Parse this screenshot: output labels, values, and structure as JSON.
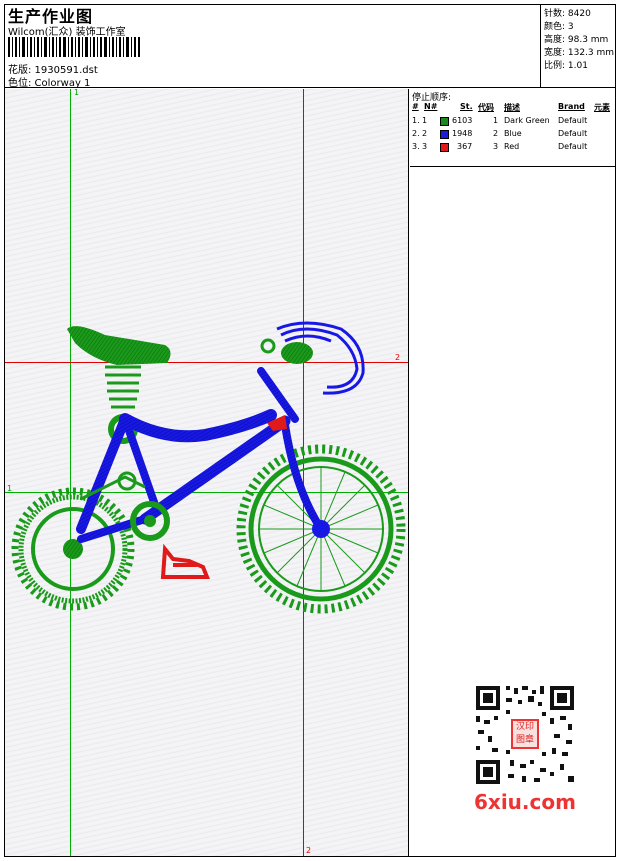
{
  "header": {
    "title": "生产作业图",
    "company": "Wilcom(汇众) 装饰工作室",
    "design_file": "花版: 1930591.dst",
    "colorway": "色位: Colorway 1"
  },
  "stats": {
    "stitches": "针数: 8420",
    "colors": "颜色: 3",
    "height": "高度: 98.3 mm",
    "width": "宽度: 132.3 mm",
    "scale": "比例: 1.01"
  },
  "guides": {
    "top_label": "1",
    "left_label": "1",
    "right_label": "2",
    "bottom_label": "2"
  },
  "stop_sequence": {
    "title": "停止顺序:",
    "headers": {
      "num": "#",
      "n": "N#",
      "st": "St.",
      "code": "代码",
      "desc": "描述",
      "brand": "Brand",
      "elem": "元素"
    },
    "rows": [
      {
        "num": "1.",
        "n": "1",
        "color": "#1a8a1a",
        "st": "6103",
        "code": "1",
        "desc": "Dark Green",
        "brand": "Default"
      },
      {
        "num": "2.",
        "n": "2",
        "color": "#1a1ae0",
        "st": "1948",
        "code": "2",
        "desc": "Blue",
        "brand": "Default"
      },
      {
        "num": "3.",
        "n": "3",
        "color": "#e01a1a",
        "st": "367",
        "code": "3",
        "desc": "Red",
        "brand": "Default"
      }
    ]
  },
  "watermark": {
    "text": "6xiu.com",
    "stamp": "汉印图章"
  },
  "colors": {
    "green": "#1a9a1a",
    "blue": "#1818e6",
    "red": "#e01a1a",
    "guide_red": "#e00000",
    "guide_green": "#00b000"
  }
}
